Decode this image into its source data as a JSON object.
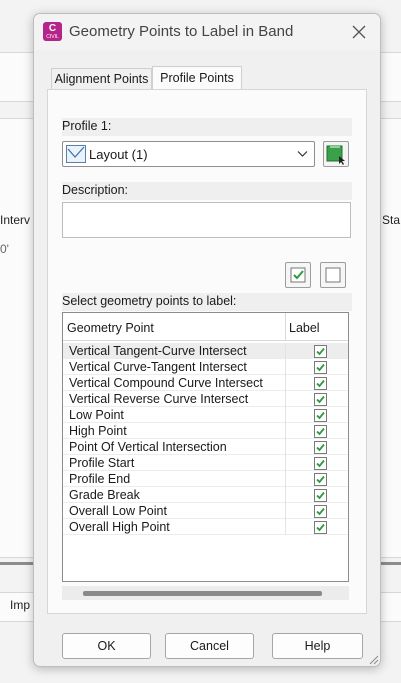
{
  "background": {
    "left_column_label": "Interv",
    "left_station": "0'",
    "right_column_label": "Sta",
    "bottom_tab_label": "Imp"
  },
  "dialog": {
    "app_icon_label": "C",
    "app_icon_sub": "CIVIL",
    "title": "Geometry Points to Label in Band",
    "close_icon": "close-icon"
  },
  "tabs": [
    {
      "label": "Alignment Points",
      "active": false
    },
    {
      "label": "Profile Points",
      "active": true
    }
  ],
  "profile": {
    "label": "Profile 1:",
    "selected": "Layout (1)"
  },
  "description": {
    "label": "Description:",
    "value": ""
  },
  "select_all_icon": "check-all-icon",
  "clear_all_icon": "clear-all-icon",
  "grid": {
    "caption": "Select geometry points to label:",
    "col_point": "Geometry Point",
    "col_label": "Label",
    "rows": [
      {
        "name": "Vertical Tangent-Curve Intersect",
        "checked": true
      },
      {
        "name": "Vertical Curve-Tangent Intersect",
        "checked": true
      },
      {
        "name": "Vertical Compound Curve Intersect",
        "checked": true
      },
      {
        "name": "Vertical Reverse Curve Intersect",
        "checked": true
      },
      {
        "name": "Low Point",
        "checked": true
      },
      {
        "name": "High Point",
        "checked": true
      },
      {
        "name": "Point Of Vertical Intersection",
        "checked": true
      },
      {
        "name": "Profile Start",
        "checked": true
      },
      {
        "name": "Profile End",
        "checked": true
      },
      {
        "name": "Grade Break",
        "checked": true
      },
      {
        "name": "Overall Low Point",
        "checked": true
      },
      {
        "name": "Overall High Point",
        "checked": true
      }
    ]
  },
  "buttons": {
    "ok": "OK",
    "cancel": "Cancel",
    "help": "Help"
  },
  "colors": {
    "check_green": "#2e9b3c",
    "app_icon": "#b5248a"
  }
}
